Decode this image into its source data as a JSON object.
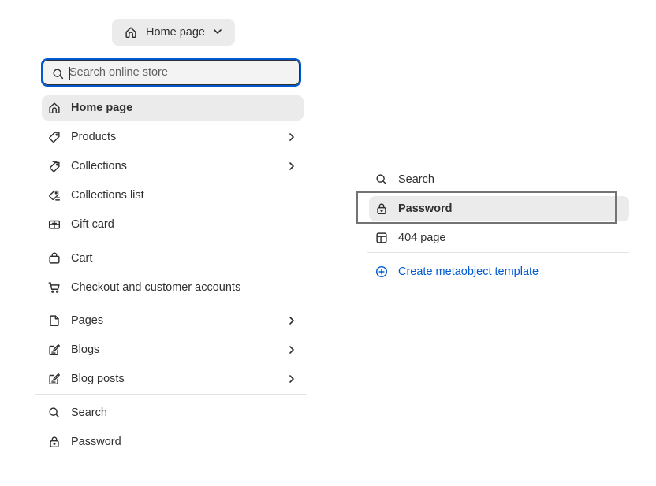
{
  "picker": {
    "label": "Home page",
    "icon": "home-icon"
  },
  "search": {
    "placeholder": "Search online store",
    "value": ""
  },
  "left_menu": {
    "items": [
      {
        "label": "Home page",
        "icon": "home-icon",
        "active": true,
        "submenu": false
      },
      {
        "label": "Products",
        "icon": "tag-icon",
        "submenu": true
      },
      {
        "label": "Collections",
        "icon": "collections-icon",
        "submenu": true
      },
      {
        "label": "Collections list",
        "icon": "collections-list-icon",
        "submenu": false
      },
      {
        "label": "Gift card",
        "icon": "gift-card-icon",
        "submenu": false
      },
      {
        "label": "Cart",
        "icon": "cart-bag-icon",
        "submenu": false
      },
      {
        "label": "Checkout and customer accounts",
        "icon": "checkout-cart-icon",
        "submenu": false
      },
      {
        "label": "Pages",
        "icon": "page-icon",
        "submenu": true
      },
      {
        "label": "Blogs",
        "icon": "blog-icon",
        "submenu": true
      },
      {
        "label": "Blog posts",
        "icon": "blog-post-icon",
        "submenu": true
      },
      {
        "label": "Search",
        "icon": "search-icon",
        "submenu": false
      },
      {
        "label": "Password",
        "icon": "lock-icon",
        "submenu": false
      }
    ]
  },
  "right_menu": {
    "items": [
      {
        "label": "Search",
        "icon": "search-icon"
      },
      {
        "label": "Password",
        "icon": "lock-icon",
        "highlighted": true
      },
      {
        "label": "404 page",
        "icon": "layout-icon"
      }
    ],
    "create_link": {
      "label": "Create metaobject template",
      "icon": "plus-circle-icon"
    }
  },
  "colors": {
    "accent": "#005bd3",
    "active_bg": "#ebebeb",
    "highlight_border": "#737373"
  }
}
